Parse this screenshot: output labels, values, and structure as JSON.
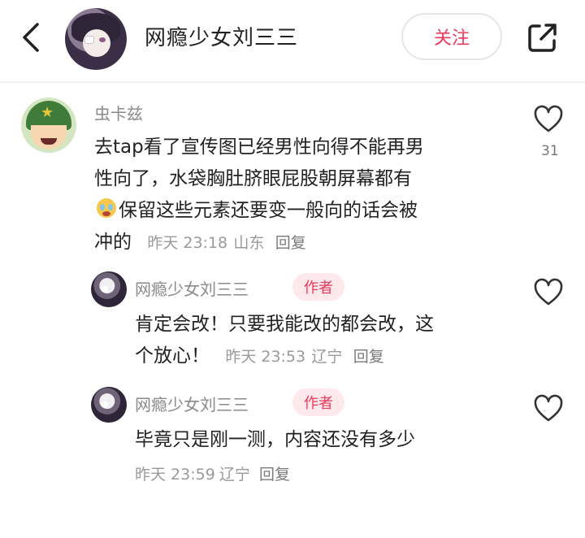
{
  "header": {
    "name": "网瘾少女刘三三",
    "follow_label": "关注"
  },
  "comments": [
    {
      "user": "虫卡兹",
      "text_lines": [
        "去tap看了宣传图已经男性向得不能再男",
        "性向了，水袋胸肚脐眼屁股朝屏幕都有",
        "保留这些元素还要变一般向的话会被",
        "冲的"
      ],
      "time": "昨天 23:18",
      "location": "山东",
      "reply_label": "回复",
      "likes": "31"
    },
    {
      "user": "网瘾少女刘三三",
      "tag": "作者",
      "text_lines": [
        "肯定会改！只要我能改的都会改，这",
        "个放心！"
      ],
      "time": "昨天 23:53",
      "location": "辽宁",
      "reply_label": "回复"
    },
    {
      "user": "网瘾少女刘三三",
      "tag": "作者",
      "text_lines": [
        "毕竟只是刚一测，内容还没有多少"
      ],
      "time": "昨天 23:59",
      "location": "辽宁",
      "reply_label": "回复"
    }
  ],
  "icons": {
    "back": "chevron-left-icon",
    "share": "share-icon",
    "like": "heart-outline-icon",
    "emoji": "crying-face-emoji"
  },
  "colors": {
    "accent": "#ec3a5e",
    "author_tag_bg": "#fde8ec",
    "meta": "#9a9a9a"
  }
}
